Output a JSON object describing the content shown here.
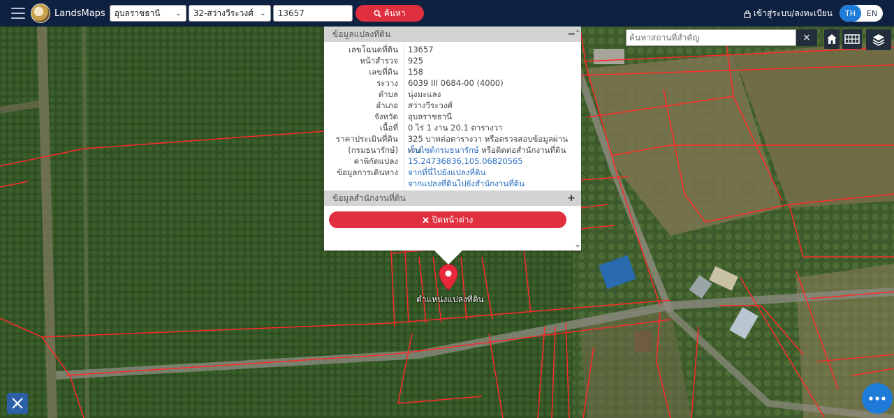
{
  "header": {
    "brand": "LandsMaps",
    "province": "อุบลราชธานี",
    "district": "32-สว่างวีระวงศ์",
    "parcel_number": "13657",
    "search_label": "ค้นหา",
    "login_label": "เข้าสู่ระบบ/ลงทะเบียน",
    "lang_th": "TH",
    "lang_en": "EN"
  },
  "popup": {
    "section1_title": "ข้อมูลแปลงที่ดิน",
    "section1_toggle": "−",
    "rows": [
      {
        "key": "เลขโฉนดที่ดิน",
        "value": "13657"
      },
      {
        "key": "หน้าสำรวจ",
        "value": "925"
      },
      {
        "key": "เลขที่ดิน",
        "value": "158"
      },
      {
        "key": "ระวาง",
        "value": "6039 III 0684-00 (4000)"
      },
      {
        "key": "ตำบล",
        "value": "นุ่งมะแลง"
      },
      {
        "key": "อำเภอ",
        "value": "สว่างวีระวงศ์"
      },
      {
        "key": "จังหวัด",
        "value": "อุบลราชธานี"
      },
      {
        "key": "เนื้อที่",
        "value": "0 ไร่ 1 งาน 20.1 ตารางวา"
      },
      {
        "key": "ราคาประเมินที่ดิน",
        "value": "325 บาทต่อตารางวา หรือตรวจสอบข้อมูลผ่านทาง"
      },
      {
        "key": "(กรมธนารักษ์)",
        "value": "เว็บไซต์กรมธนารักษ์",
        "value_suffix": " หรือติดต่อสำนักงานที่ดิน"
      },
      {
        "key": "ค่าพิกัดแปลง",
        "value": "15.24736836,105.06820565"
      },
      {
        "key": "ข้อมูลการเดินทาง",
        "value": "จากที่นี่ไปยังแปลงที่ดิน"
      },
      {
        "key": "",
        "value": "จากแปลงที่ดินไปยังสำนักงานที่ดิน"
      }
    ],
    "section2_title": "ข้อมูลสำนักงานที่ดิน",
    "section2_toggle": "+",
    "close_label": "ปิดหน้าต่าง"
  },
  "map": {
    "marker_label": "ตำแหน่งแปลงที่ดิน",
    "place_search_placeholder": "ค้นหาสถานที่สำคัญ",
    "place_clear": "×"
  },
  "colors": {
    "header_bg": "#0f2140",
    "accent_red": "#e0303f",
    "accent_blue": "#1f7bd8",
    "link": "#2a6fc2",
    "parcel_line": "#ff2a2a"
  }
}
